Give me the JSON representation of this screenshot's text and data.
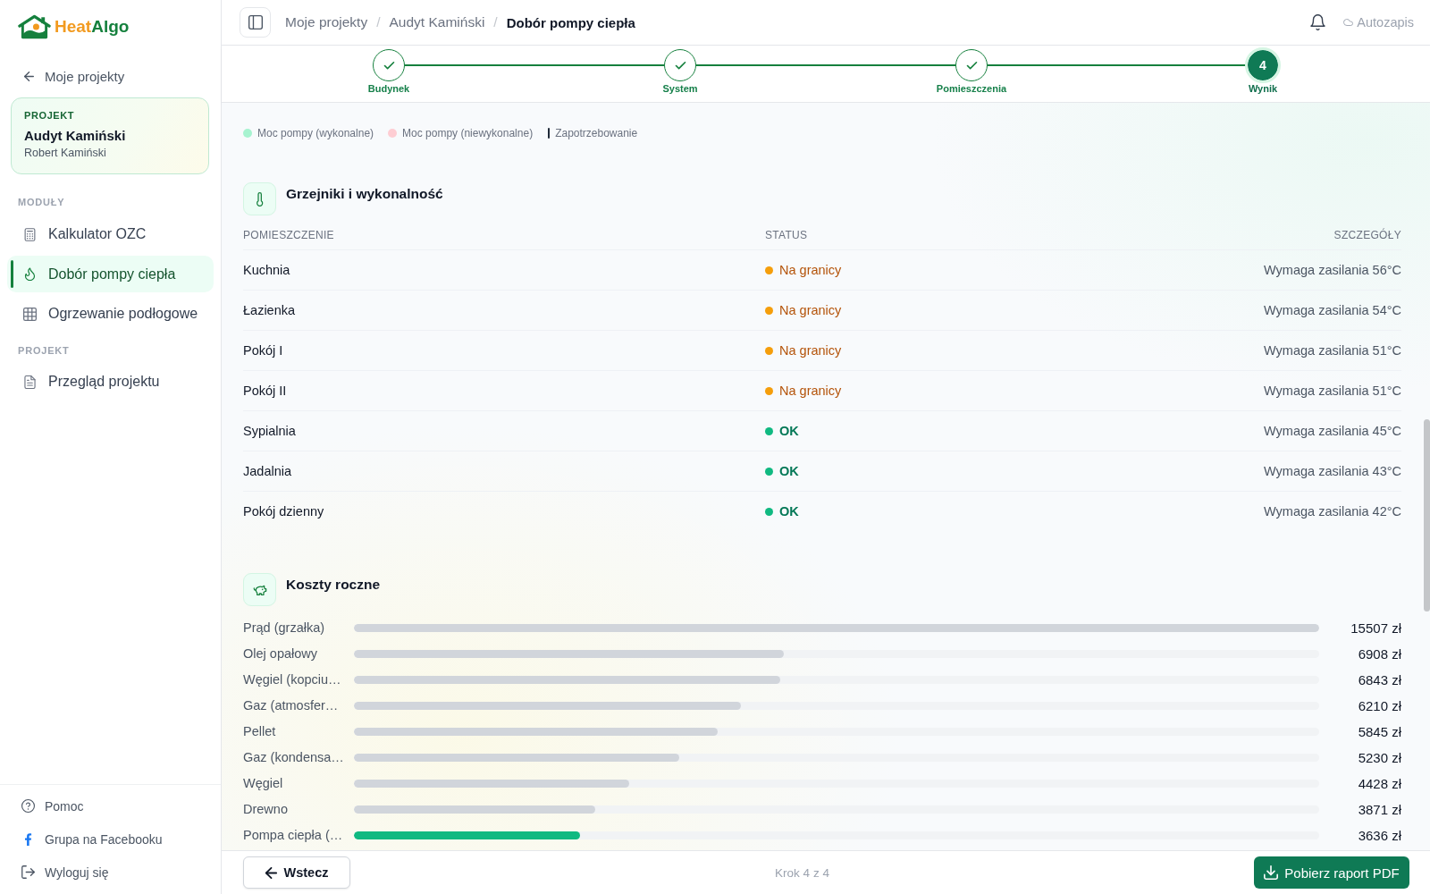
{
  "sidebar": {
    "logo": {
      "words": [
        {
          "text": "Heat",
          "color": "#f29a1f"
        },
        {
          "text": "Algo",
          "color": "#15803d"
        }
      ]
    },
    "back_link": "Moje projekty",
    "project_card": {
      "label": "PROJEKT",
      "name": "Audyt Kamiński",
      "client": "Robert Kamiński"
    },
    "sections": [
      {
        "heading": "MODUŁY",
        "items": [
          {
            "label": "Kalkulator OZC",
            "selected": false
          },
          {
            "label": "Dobór pompy ciepła",
            "selected": true
          },
          {
            "label": "Ogrzewanie podłogowe",
            "selected": false
          }
        ]
      },
      {
        "heading": "PROJEKT",
        "items": [
          {
            "label": "Przegląd projektu",
            "selected": false
          }
        ]
      }
    ],
    "footer_links": [
      "Pomoc",
      "Grupa na Facebooku",
      "Wyloguj się"
    ]
  },
  "top_bar": {
    "breadcrumbs": [
      {
        "label": "Moje projekty",
        "current": false
      },
      {
        "separator": "/",
        "label": "Audyt Kamiński",
        "current": false
      },
      {
        "separator": "/",
        "label": "Dobór pompy ciepła",
        "current": true
      }
    ],
    "autosave": "Autozapis"
  },
  "stepper": {
    "steps": [
      {
        "label": "Budynek",
        "completed": true,
        "selected": false
      },
      {
        "label": "System",
        "completed": true,
        "selected": false
      },
      {
        "label": "Pomieszczenia",
        "completed": true,
        "selected": false
      },
      {
        "label": "Wynik",
        "completed": false,
        "selected": true,
        "number": "4"
      }
    ]
  },
  "chart_legend": [
    {
      "label": "Moc pompy (wykonalne)",
      "kind": "dot",
      "color": "#a7f3d0"
    },
    {
      "label": "Moc pompy (niewykonalne)",
      "kind": "dot",
      "color": "#fecdd3"
    },
    {
      "label": "Zapotrzebowanie",
      "kind": "line",
      "color": "#1f2937"
    }
  ],
  "radiators": {
    "title": "Grzejniki i wykonalność",
    "columns": [
      "POMIESZCZENIE",
      "STATUS",
      "SZCZEGÓŁY"
    ],
    "rows": [
      {
        "room": "Kuchnia",
        "status": {
          "kind": "warning",
          "label": "Na granicy"
        },
        "details": "Wymaga zasilania 56°C"
      },
      {
        "room": "Łazienka",
        "status": {
          "kind": "warning",
          "label": "Na granicy"
        },
        "details": "Wymaga zasilania 54°C"
      },
      {
        "room": "Pokój I",
        "status": {
          "kind": "warning",
          "label": "Na granicy"
        },
        "details": "Wymaga zasilania 51°C"
      },
      {
        "room": "Pokój II",
        "status": {
          "kind": "warning",
          "label": "Na granicy"
        },
        "details": "Wymaga zasilania 51°C"
      },
      {
        "room": "Sypialnia",
        "status": {
          "kind": "ok",
          "label": "OK"
        },
        "details": "Wymaga zasilania 45°C"
      },
      {
        "room": "Jadalnia",
        "status": {
          "kind": "ok",
          "label": "OK"
        },
        "details": "Wymaga zasilania 43°C"
      },
      {
        "room": "Pokój dzienny",
        "status": {
          "kind": "ok",
          "label": "OK"
        },
        "details": "Wymaga zasilania 42°C"
      }
    ]
  },
  "annual_costs": {
    "title": "Koszty roczne",
    "rows": [
      {
        "label": "Prąd (grzałka)",
        "level": 1.0,
        "value": "15507 zł",
        "highlighted": false
      },
      {
        "label": "Olej opałowy",
        "level": 0.4455,
        "value": "6908 zł",
        "highlighted": false
      },
      {
        "label": "Węgiel (kopciu…",
        "level": 0.4413,
        "value": "6843 zł",
        "highlighted": false
      },
      {
        "label": "Gaz (atmosfer…",
        "level": 0.4005,
        "value": "6210 zł",
        "highlighted": false
      },
      {
        "label": "Pellet",
        "level": 0.3769,
        "value": "5845 zł",
        "highlighted": false
      },
      {
        "label": "Gaz (kondensa…",
        "level": 0.3373,
        "value": "5230 zł",
        "highlighted": false
      },
      {
        "label": "Węgiel",
        "level": 0.2855,
        "value": "4428 zł",
        "highlighted": false
      },
      {
        "label": "Drewno",
        "level": 0.2496,
        "value": "3871 zł",
        "highlighted": false
      },
      {
        "label": "Pompa ciepła (…",
        "level": 0.2345,
        "value": "3636 zł",
        "highlighted": true
      }
    ]
  },
  "footer": {
    "back_button": "Wstecz",
    "step_info": "Krok 4 z 4",
    "download_button": "Pobierz raport PDF"
  }
}
